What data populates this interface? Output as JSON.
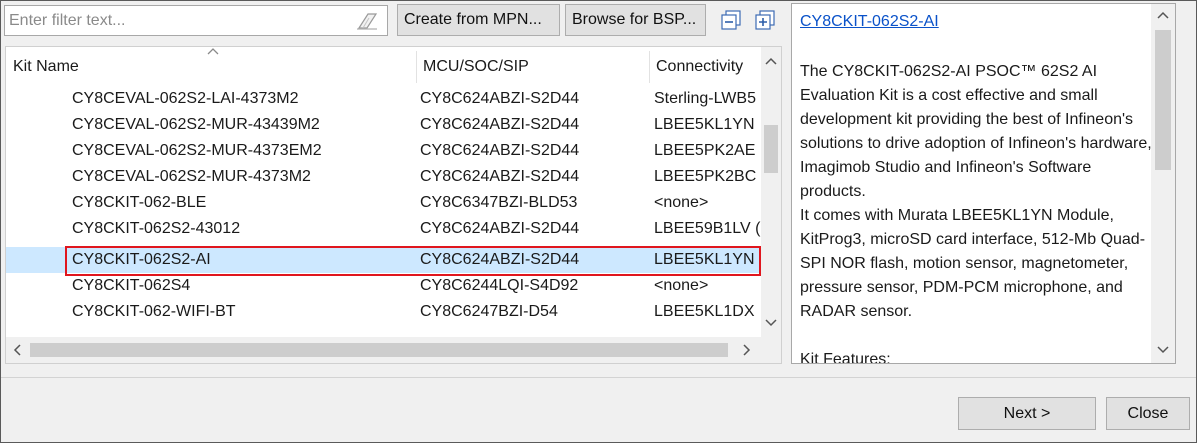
{
  "toolbar": {
    "filter_placeholder": "Enter filter text...",
    "create_from_mpn": "Create from MPN...",
    "browse_for_bsp": "Browse for BSP..."
  },
  "table": {
    "columns": [
      "Kit Name",
      "MCU/SOC/SIP",
      "Connectivity"
    ],
    "rows": [
      {
        "kit": "CY8CEVAL-062S2-LAI-4373M2",
        "mcu": "CY8C624ABZI-S2D44",
        "conn": "Sterling-LWB5"
      },
      {
        "kit": "CY8CEVAL-062S2-MUR-43439M2",
        "mcu": "CY8C624ABZI-S2D44",
        "conn": "LBEE5KL1YN"
      },
      {
        "kit": "CY8CEVAL-062S2-MUR-4373EM2",
        "mcu": "CY8C624ABZI-S2D44",
        "conn": "LBEE5PK2AE"
      },
      {
        "kit": "CY8CEVAL-062S2-MUR-4373M2",
        "mcu": "CY8C624ABZI-S2D44",
        "conn": "LBEE5PK2BC"
      },
      {
        "kit": "CY8CKIT-062-BLE",
        "mcu": "CY8C6347BZI-BLD53",
        "conn": "<none>"
      },
      {
        "kit": "CY8CKIT-062S2-43012",
        "mcu": "CY8C624ABZI-S2D44",
        "conn": "LBEE59B1LV ("
      },
      {
        "kit": "CY8CKIT-062S2-AI",
        "mcu": "CY8C624ABZI-S2D44",
        "conn": "LBEE5KL1YN",
        "selected": true
      },
      {
        "kit": "CY8CKIT-062S4",
        "mcu": "CY8C6244LQI-S4D92",
        "conn": "<none>"
      },
      {
        "kit": "CY8CKIT-062-WIFI-BT",
        "mcu": "CY8C6247BZI-D54",
        "conn": "LBEE5KL1DX"
      }
    ]
  },
  "description": {
    "link": "CY8CKIT-062S2-AI",
    "text": "The CY8CKIT-062S2-AI PSOC™ 62S2 AI Evaluation Kit is a cost effective and small development kit providing the best of Infineon's solutions to drive adoption of Infineon's hardware, Imagimob Studio and Infineon's Software products.",
    "text2": "It comes with Murata LBEE5KL1YN Module, KitProg3, microSD card interface, 512-Mb Quad-SPI NOR flash, motion sensor, magnetometer, pressure sensor, PDM-PCM microphone, and RADAR sensor.",
    "features": "Kit Features:"
  },
  "footer": {
    "next": "Next >",
    "close": "Close"
  },
  "colors": {
    "selection": "#cde8ff",
    "highlight_border": "#e0161e",
    "link": "#0a52c9"
  }
}
